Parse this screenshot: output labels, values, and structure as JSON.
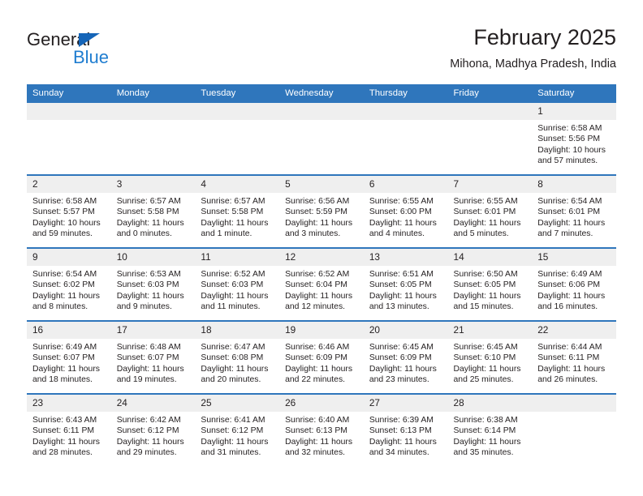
{
  "logo": {
    "word_one": "General",
    "word_two": "Blue",
    "triangle_icon": "triangle-icon",
    "brand_blue": "#1f7dd0",
    "brand_dark": "#231f20"
  },
  "header": {
    "title": "February 2025",
    "subtitle": "Mihona, Madhya Pradesh, India"
  },
  "calendar": {
    "header_color": "#2f76bc",
    "daynum_background": "#efefef",
    "weekdays": [
      "Sunday",
      "Monday",
      "Tuesday",
      "Wednesday",
      "Thursday",
      "Friday",
      "Saturday"
    ],
    "weeks": [
      [
        {
          "day": "",
          "lines": []
        },
        {
          "day": "",
          "lines": []
        },
        {
          "day": "",
          "lines": []
        },
        {
          "day": "",
          "lines": []
        },
        {
          "day": "",
          "lines": []
        },
        {
          "day": "",
          "lines": []
        },
        {
          "day": "1",
          "lines": [
            "Sunrise: 6:58 AM",
            "Sunset: 5:56 PM",
            "Daylight: 10 hours and 57 minutes."
          ],
          "sunrise": "6:58 AM",
          "sunset": "5:56 PM",
          "daylight": "10 hours and 57 minutes."
        }
      ],
      [
        {
          "day": "2",
          "lines": [
            "Sunrise: 6:58 AM",
            "Sunset: 5:57 PM",
            "Daylight: 10 hours and 59 minutes."
          ],
          "sunrise": "6:58 AM",
          "sunset": "5:57 PM",
          "daylight": "10 hours and 59 minutes."
        },
        {
          "day": "3",
          "lines": [
            "Sunrise: 6:57 AM",
            "Sunset: 5:58 PM",
            "Daylight: 11 hours and 0 minutes."
          ],
          "sunrise": "6:57 AM",
          "sunset": "5:58 PM",
          "daylight": "11 hours and 0 minutes."
        },
        {
          "day": "4",
          "lines": [
            "Sunrise: 6:57 AM",
            "Sunset: 5:58 PM",
            "Daylight: 11 hours and 1 minute."
          ],
          "sunrise": "6:57 AM",
          "sunset": "5:58 PM",
          "daylight": "11 hours and 1 minute."
        },
        {
          "day": "5",
          "lines": [
            "Sunrise: 6:56 AM",
            "Sunset: 5:59 PM",
            "Daylight: 11 hours and 3 minutes."
          ],
          "sunrise": "6:56 AM",
          "sunset": "5:59 PM",
          "daylight": "11 hours and 3 minutes."
        },
        {
          "day": "6",
          "lines": [
            "Sunrise: 6:55 AM",
            "Sunset: 6:00 PM",
            "Daylight: 11 hours and 4 minutes."
          ],
          "sunrise": "6:55 AM",
          "sunset": "6:00 PM",
          "daylight": "11 hours and 4 minutes."
        },
        {
          "day": "7",
          "lines": [
            "Sunrise: 6:55 AM",
            "Sunset: 6:01 PM",
            "Daylight: 11 hours and 5 minutes."
          ],
          "sunrise": "6:55 AM",
          "sunset": "6:01 PM",
          "daylight": "11 hours and 5 minutes."
        },
        {
          "day": "8",
          "lines": [
            "Sunrise: 6:54 AM",
            "Sunset: 6:01 PM",
            "Daylight: 11 hours and 7 minutes."
          ],
          "sunrise": "6:54 AM",
          "sunset": "6:01 PM",
          "daylight": "11 hours and 7 minutes."
        }
      ],
      [
        {
          "day": "9",
          "lines": [
            "Sunrise: 6:54 AM",
            "Sunset: 6:02 PM",
            "Daylight: 11 hours and 8 minutes."
          ],
          "sunrise": "6:54 AM",
          "sunset": "6:02 PM",
          "daylight": "11 hours and 8 minutes."
        },
        {
          "day": "10",
          "lines": [
            "Sunrise: 6:53 AM",
            "Sunset: 6:03 PM",
            "Daylight: 11 hours and 9 minutes."
          ],
          "sunrise": "6:53 AM",
          "sunset": "6:03 PM",
          "daylight": "11 hours and 9 minutes."
        },
        {
          "day": "11",
          "lines": [
            "Sunrise: 6:52 AM",
            "Sunset: 6:03 PM",
            "Daylight: 11 hours and 11 minutes."
          ],
          "sunrise": "6:52 AM",
          "sunset": "6:03 PM",
          "daylight": "11 hours and 11 minutes."
        },
        {
          "day": "12",
          "lines": [
            "Sunrise: 6:52 AM",
            "Sunset: 6:04 PM",
            "Daylight: 11 hours and 12 minutes."
          ],
          "sunrise": "6:52 AM",
          "sunset": "6:04 PM",
          "daylight": "11 hours and 12 minutes."
        },
        {
          "day": "13",
          "lines": [
            "Sunrise: 6:51 AM",
            "Sunset: 6:05 PM",
            "Daylight: 11 hours and 13 minutes."
          ],
          "sunrise": "6:51 AM",
          "sunset": "6:05 PM",
          "daylight": "11 hours and 13 minutes."
        },
        {
          "day": "14",
          "lines": [
            "Sunrise: 6:50 AM",
            "Sunset: 6:05 PM",
            "Daylight: 11 hours and 15 minutes."
          ],
          "sunrise": "6:50 AM",
          "sunset": "6:05 PM",
          "daylight": "11 hours and 15 minutes."
        },
        {
          "day": "15",
          "lines": [
            "Sunrise: 6:49 AM",
            "Sunset: 6:06 PM",
            "Daylight: 11 hours and 16 minutes."
          ],
          "sunrise": "6:49 AM",
          "sunset": "6:06 PM",
          "daylight": "11 hours and 16 minutes."
        }
      ],
      [
        {
          "day": "16",
          "lines": [
            "Sunrise: 6:49 AM",
            "Sunset: 6:07 PM",
            "Daylight: 11 hours and 18 minutes."
          ],
          "sunrise": "6:49 AM",
          "sunset": "6:07 PM",
          "daylight": "11 hours and 18 minutes."
        },
        {
          "day": "17",
          "lines": [
            "Sunrise: 6:48 AM",
            "Sunset: 6:07 PM",
            "Daylight: 11 hours and 19 minutes."
          ],
          "sunrise": "6:48 AM",
          "sunset": "6:07 PM",
          "daylight": "11 hours and 19 minutes."
        },
        {
          "day": "18",
          "lines": [
            "Sunrise: 6:47 AM",
            "Sunset: 6:08 PM",
            "Daylight: 11 hours and 20 minutes."
          ],
          "sunrise": "6:47 AM",
          "sunset": "6:08 PM",
          "daylight": "11 hours and 20 minutes."
        },
        {
          "day": "19",
          "lines": [
            "Sunrise: 6:46 AM",
            "Sunset: 6:09 PM",
            "Daylight: 11 hours and 22 minutes."
          ],
          "sunrise": "6:46 AM",
          "sunset": "6:09 PM",
          "daylight": "11 hours and 22 minutes."
        },
        {
          "day": "20",
          "lines": [
            "Sunrise: 6:45 AM",
            "Sunset: 6:09 PM",
            "Daylight: 11 hours and 23 minutes."
          ],
          "sunrise": "6:45 AM",
          "sunset": "6:09 PM",
          "daylight": "11 hours and 23 minutes."
        },
        {
          "day": "21",
          "lines": [
            "Sunrise: 6:45 AM",
            "Sunset: 6:10 PM",
            "Daylight: 11 hours and 25 minutes."
          ],
          "sunrise": "6:45 AM",
          "sunset": "6:10 PM",
          "daylight": "11 hours and 25 minutes."
        },
        {
          "day": "22",
          "lines": [
            "Sunrise: 6:44 AM",
            "Sunset: 6:11 PM",
            "Daylight: 11 hours and 26 minutes."
          ],
          "sunrise": "6:44 AM",
          "sunset": "6:11 PM",
          "daylight": "11 hours and 26 minutes."
        }
      ],
      [
        {
          "day": "23",
          "lines": [
            "Sunrise: 6:43 AM",
            "Sunset: 6:11 PM",
            "Daylight: 11 hours and 28 minutes."
          ],
          "sunrise": "6:43 AM",
          "sunset": "6:11 PM",
          "daylight": "11 hours and 28 minutes."
        },
        {
          "day": "24",
          "lines": [
            "Sunrise: 6:42 AM",
            "Sunset: 6:12 PM",
            "Daylight: 11 hours and 29 minutes."
          ],
          "sunrise": "6:42 AM",
          "sunset": "6:12 PM",
          "daylight": "11 hours and 29 minutes."
        },
        {
          "day": "25",
          "lines": [
            "Sunrise: 6:41 AM",
            "Sunset: 6:12 PM",
            "Daylight: 11 hours and 31 minutes."
          ],
          "sunrise": "6:41 AM",
          "sunset": "6:12 PM",
          "daylight": "11 hours and 31 minutes."
        },
        {
          "day": "26",
          "lines": [
            "Sunrise: 6:40 AM",
            "Sunset: 6:13 PM",
            "Daylight: 11 hours and 32 minutes."
          ],
          "sunrise": "6:40 AM",
          "sunset": "6:13 PM",
          "daylight": "11 hours and 32 minutes."
        },
        {
          "day": "27",
          "lines": [
            "Sunrise: 6:39 AM",
            "Sunset: 6:13 PM",
            "Daylight: 11 hours and 34 minutes."
          ],
          "sunrise": "6:39 AM",
          "sunset": "6:13 PM",
          "daylight": "11 hours and 34 minutes."
        },
        {
          "day": "28",
          "lines": [
            "Sunrise: 6:38 AM",
            "Sunset: 6:14 PM",
            "Daylight: 11 hours and 35 minutes."
          ],
          "sunrise": "6:38 AM",
          "sunset": "6:14 PM",
          "daylight": "11 hours and 35 minutes."
        },
        {
          "day": "",
          "lines": []
        }
      ]
    ]
  }
}
